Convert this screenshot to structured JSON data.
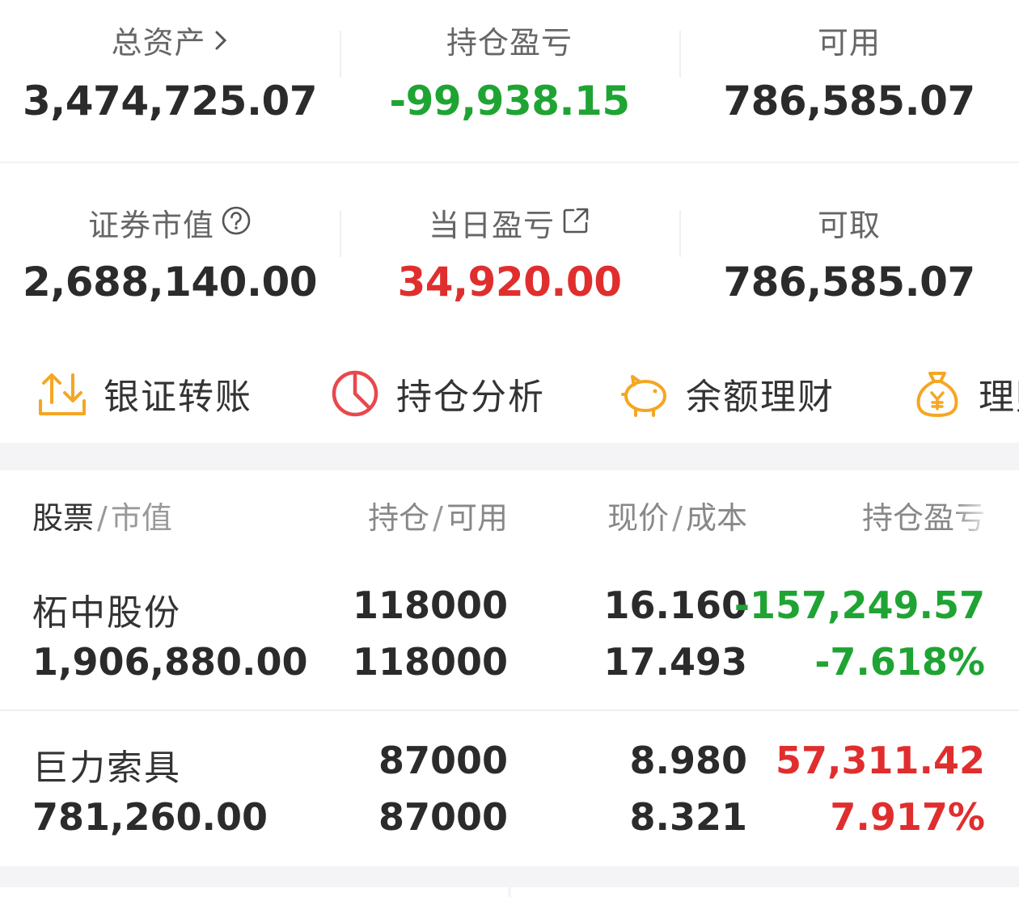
{
  "summary": {
    "total_assets": {
      "label": "总资产",
      "value": "3,474,725.07"
    },
    "position_pnl": {
      "label": "持仓盈亏",
      "value": "-99,938.15"
    },
    "available": {
      "label": "可用",
      "value": "786,585.07"
    },
    "market_value": {
      "label": "证券市值",
      "value": "2,688,140.00"
    },
    "daily_pnl": {
      "label": "当日盈亏",
      "value": "34,920.00"
    },
    "withdrawable": {
      "label": "可取",
      "value": "786,585.07"
    }
  },
  "actions": [
    {
      "label": "银证转账",
      "icon": "transfer-icon"
    },
    {
      "label": "持仓分析",
      "icon": "pie-chart-icon"
    },
    {
      "label": "余额理财",
      "icon": "piggy-bank-icon"
    },
    {
      "label": "理财",
      "icon": "money-bag-icon"
    }
  ],
  "table": {
    "headers": [
      {
        "main": "股票",
        "sub": "市值"
      },
      {
        "main": "持仓",
        "sub": "可用"
      },
      {
        "main": "现价",
        "sub": "成本"
      },
      {
        "main": "持仓盈亏",
        "sub": ""
      }
    ],
    "rows": [
      {
        "name": "柘中股份",
        "market_value": "1,906,880.00",
        "position": "118000",
        "available": "118000",
        "price": "16.160",
        "cost": "17.493",
        "pnl": "-157,249.57",
        "pnl_pct": "-7.618%"
      },
      {
        "name": "巨力索具",
        "market_value": "781,260.00",
        "position": "87000",
        "available": "87000",
        "price": "8.980",
        "cost": "8.321",
        "pnl": "57,311.42",
        "pnl_pct": "7.917%"
      }
    ]
  },
  "colors": {
    "gain": "#e02e2e",
    "loss": "#1fa433",
    "accent": "#f5a623"
  }
}
